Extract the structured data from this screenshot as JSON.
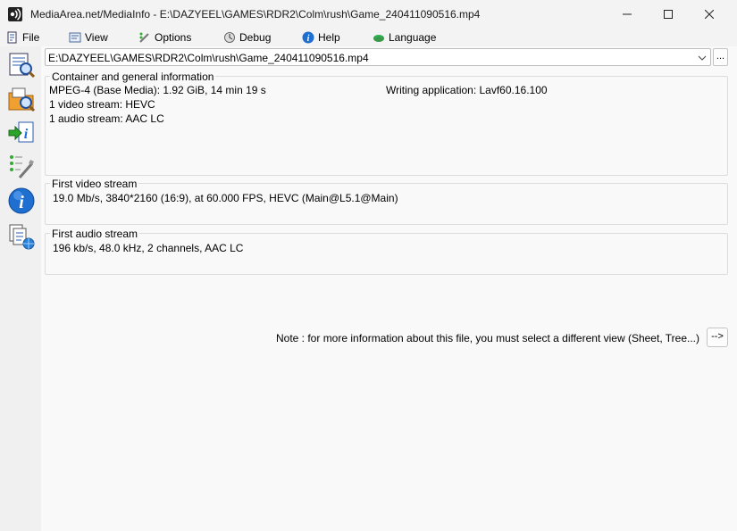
{
  "window": {
    "title": "MediaArea.net/MediaInfo - E:\\DAZYEEL\\GAMES\\RDR2\\Colm\\rush\\Game_240411090516.mp4"
  },
  "menu": {
    "file": "File",
    "view": "View",
    "options": "Options",
    "debug": "Debug",
    "help": "Help",
    "language": "Language"
  },
  "file_path": "E:\\DAZYEEL\\GAMES\\RDR2\\Colm\\rush\\Game_240411090516.mp4",
  "browse_label": "...",
  "general": {
    "legend": "Container and general information",
    "format_line": "MPEG-4 (Base Media): 1.92 GiB, 14 min 19 s",
    "writing_app": "Writing application: Lavf60.16.100",
    "video_count": "1 video stream: HEVC",
    "audio_count": "1 audio stream: AAC LC"
  },
  "video": {
    "legend": "First video stream",
    "details": "19.0 Mb/s, 3840*2160 (16:9), at 60.000 FPS, HEVC (Main@L5.1@Main)"
  },
  "audio": {
    "legend": "First audio stream",
    "details": "196 kb/s, 48.0 kHz, 2 channels, AAC LC"
  },
  "note": "Note : for more information about this file, you must select a different view (Sheet, Tree...)",
  "more_button": "-->",
  "toolbar_icons": [
    "open-file-icon",
    "open-folder-icon",
    "export-icon",
    "preferences-icon",
    "about-icon",
    "web-knowledge-icon"
  ]
}
